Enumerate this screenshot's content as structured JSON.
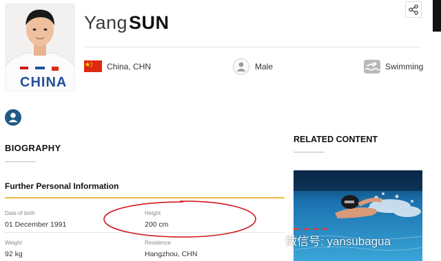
{
  "athlete": {
    "first_name": "Yang",
    "last_name": "SUN",
    "jersey_text": "CHINA",
    "country": "China, CHN",
    "gender": "Male",
    "sport": "Swimming"
  },
  "sections": {
    "biography": "BIOGRAPHY",
    "further_info": "Further Personal Information",
    "related": "RELATED CONTENT"
  },
  "details": {
    "dob_label": "Date of birth",
    "dob_value": "01 December 1991",
    "height_label": "Height",
    "height_value": "200 cm",
    "weight_label": "Weight",
    "weight_value": "92 kg",
    "residence_label": "Residence",
    "residence_value": "Hangzhou, CHN"
  },
  "watermark": "微信号: yansubagua",
  "colors": {
    "accent_gold": "#f0b83e",
    "badge_blue": "#1f5a86",
    "flag_red": "#de2910",
    "annotation_red": "#d0161b"
  },
  "icons": [
    "share-icon",
    "china-flag-icon",
    "gender-icon",
    "swimming-icon",
    "user-icon",
    "wechat-icon"
  ]
}
